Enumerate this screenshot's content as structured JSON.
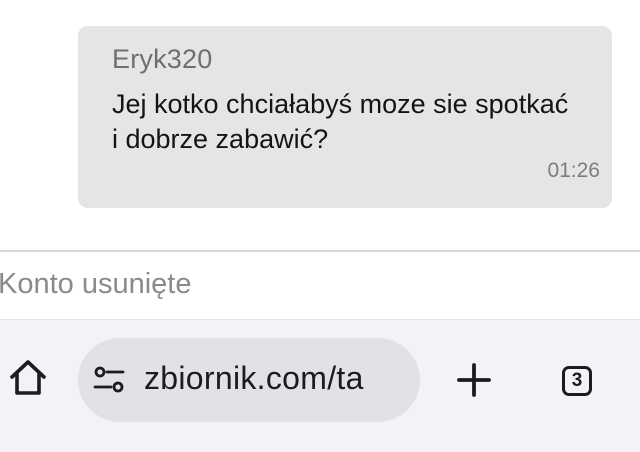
{
  "message": {
    "sender": "Eryk320",
    "text": "Jej kotko chciałabyś moze sie spotkać\ni dobrze zabawić?",
    "time": "01:26"
  },
  "reply": {
    "label": "Konto usunięte"
  },
  "browser_toolbar": {
    "url": "zbiornik.com/ta",
    "tab_count": "3",
    "icons": {
      "home": "home-icon",
      "site_settings": "tune-icon",
      "new_tab": "plus-icon",
      "tabs": "tab-switcher-icon"
    }
  },
  "colors": {
    "bubble": "#e5e5e5",
    "toolbar": "#f4f1f7",
    "url_box": "#e3e0e8"
  }
}
